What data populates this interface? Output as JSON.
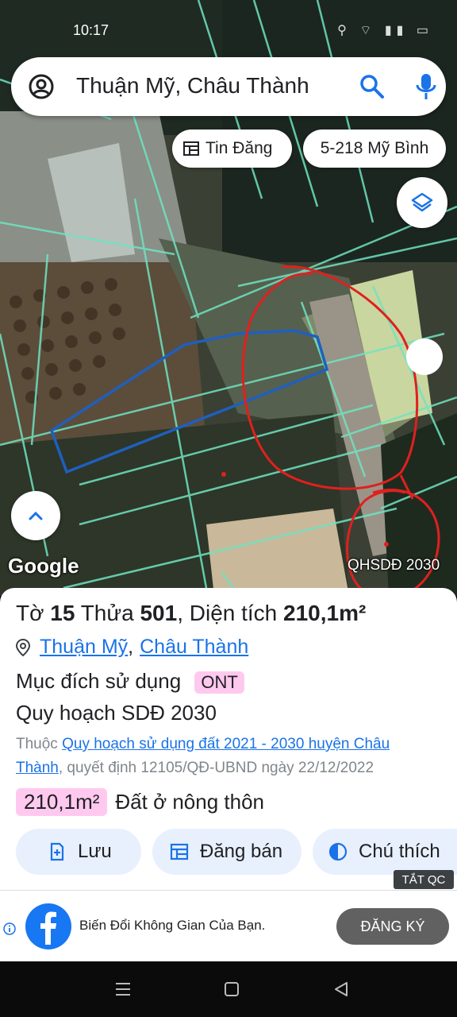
{
  "status_bar": {
    "time": "10:17",
    "icons": "⚲ ⌔ ▮▮ ▭"
  },
  "search": {
    "query": "Thuận Mỹ, Châu Thành"
  },
  "chips": {
    "posts_label": "Tin Đăng",
    "address_label": "5-218 Mỹ Bình"
  },
  "map": {
    "google_label": "Google",
    "layer_label": "QHSDĐ 2030"
  },
  "parcel": {
    "to_label": "Tờ",
    "to_value": "15",
    "thua_label": "Thửa",
    "thua_value": "501",
    "area_label": "Diện tích",
    "area_value": "210,1m²",
    "ward_link": "Thuận Mỹ",
    "separator": ",",
    "district_link": "Châu Thành",
    "purpose_label": "Mục đích sử dụng",
    "purpose_code": "ONT",
    "plan_title": "Quy hoạch SDĐ 2030",
    "belongs_prefix": "Thuộc",
    "belongs_link": "Quy hoạch sử dụng đất 2021 - 2030 huyện Châu Thành",
    "belongs_suffix": ", quyết định 12105/QĐ-UBND ngày 22/12/2022",
    "area_pill": "210,1m²",
    "land_type": "Đất ở nông thôn"
  },
  "actions": {
    "save_label": "Lưu",
    "sell_label": "Đăng bán",
    "legend_label": "Chú thích"
  },
  "ad": {
    "hide_label": "TẮT QC",
    "text": "Biến Đổi Không Gian Của Bạn.",
    "cta_label": "ĐĂNG KÝ"
  },
  "colors": {
    "accent": "#1a73e8",
    "badge": "#ffc9ef",
    "parcel_outline": "#1f5fbf",
    "annotation": "#e0201f",
    "cadastral_lines": "#6fe3c2"
  }
}
